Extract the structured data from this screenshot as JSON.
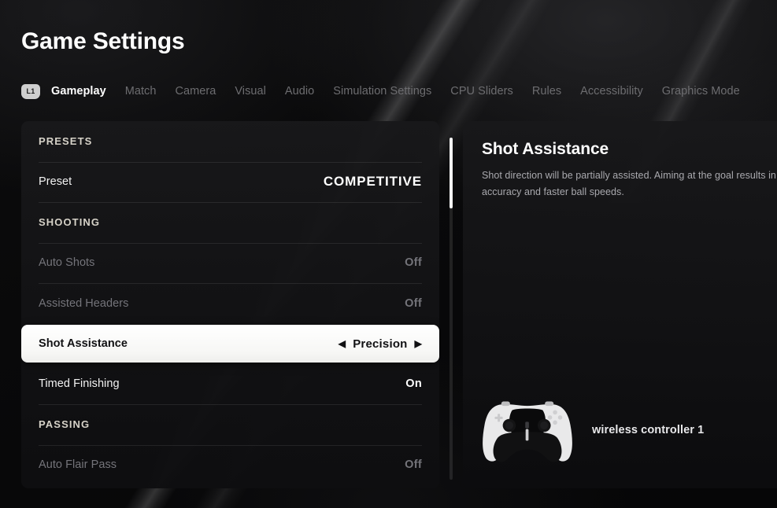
{
  "header": {
    "title": "Game Settings"
  },
  "tabbar": {
    "bumper_icon": "l1-bumper-icon",
    "bumper_label": "L1",
    "tabs": [
      {
        "label": "Gameplay",
        "active": true
      },
      {
        "label": "Match",
        "active": false
      },
      {
        "label": "Camera",
        "active": false
      },
      {
        "label": "Visual",
        "active": false
      },
      {
        "label": "Audio",
        "active": false
      },
      {
        "label": "Simulation Settings",
        "active": false
      },
      {
        "label": "CPU Sliders",
        "active": false
      },
      {
        "label": "Rules",
        "active": false
      },
      {
        "label": "Accessibility",
        "active": false
      },
      {
        "label": "Graphics Mode",
        "active": false
      }
    ]
  },
  "settings_list": {
    "rows": [
      {
        "label": "PRESETS",
        "value": "",
        "kind": "section"
      },
      {
        "label": "Preset",
        "value": "COMPETITIVE",
        "kind": "preset"
      },
      {
        "label": "SHOOTING",
        "value": "",
        "kind": "section"
      },
      {
        "label": "Auto Shots",
        "value": "Off",
        "kind": "dim"
      },
      {
        "label": "Assisted Headers",
        "value": "Off",
        "kind": "dim"
      },
      {
        "label": "Shot Assistance",
        "value": "Precision",
        "kind": "selected",
        "left_arrow": "◀",
        "right_arrow": "▶"
      },
      {
        "label": "Timed Finishing",
        "value": "On",
        "kind": "normal"
      },
      {
        "label": "PASSING",
        "value": "",
        "kind": "section"
      },
      {
        "label": "Auto Flair Pass",
        "value": "Off",
        "kind": "dim"
      }
    ]
  },
  "scrollbar": {
    "name": "settings-list-scrollbar"
  },
  "detail": {
    "title": "Shot Assistance",
    "description": "Shot direction will be partially assisted. Aiming at the goal results in more accuracy and faster ball speeds."
  },
  "controller": {
    "icon": "playstation-dualsense-controller-icon",
    "label": "wireless controller 1"
  },
  "colors": {
    "background": "#09090a",
    "panel": "#18181a",
    "selected_row": "#ffffff",
    "text_primary": "#ffffff",
    "text_muted": "#74747a",
    "text_body": "#a9a9ae",
    "section_header": "#d6d2c8"
  }
}
